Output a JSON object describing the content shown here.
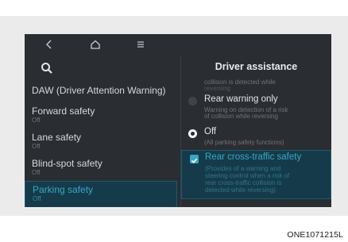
{
  "nav": {
    "back_icon": "chevron-left-icon",
    "home_icon": "home-icon",
    "menu_icon": "menu-icon"
  },
  "left_menu": {
    "search_icon": "search-icon",
    "items": [
      {
        "title": "DAW (Driver Attention Warning)",
        "sub": ""
      },
      {
        "title": "Forward safety",
        "sub": "Off"
      },
      {
        "title": "Lane safety",
        "sub": "Off"
      },
      {
        "title": "Blind-spot safety",
        "sub": "Off"
      },
      {
        "title": "Parking safety",
        "sub": "Off",
        "selected": true
      }
    ]
  },
  "right_panel": {
    "title": "Driver assistance",
    "cut_desc_1": "collision is detected while",
    "cut_desc_2": "reversing",
    "options": [
      {
        "label": "Rear warning only",
        "desc_1": "Warning on detection of a risk",
        "desc_2": "of collision while reversing",
        "state": "unselected"
      },
      {
        "label": "Off",
        "desc_1": "(All parking safety functions)",
        "state": "selected"
      }
    ],
    "check_option": {
      "label": "Rear cross-traffic safety",
      "desc_1": "(Provides of a warning and",
      "desc_2": "steering control when a risk of",
      "desc_3": "rear cross-traffic collision is",
      "desc_4": "detected while reversing)",
      "checked": true
    }
  },
  "caption": "ONE1071215L",
  "colors": {
    "screen_bg": "#2a2d32",
    "accent": "#3aa6c4",
    "selected_bg": "#153b4a"
  }
}
